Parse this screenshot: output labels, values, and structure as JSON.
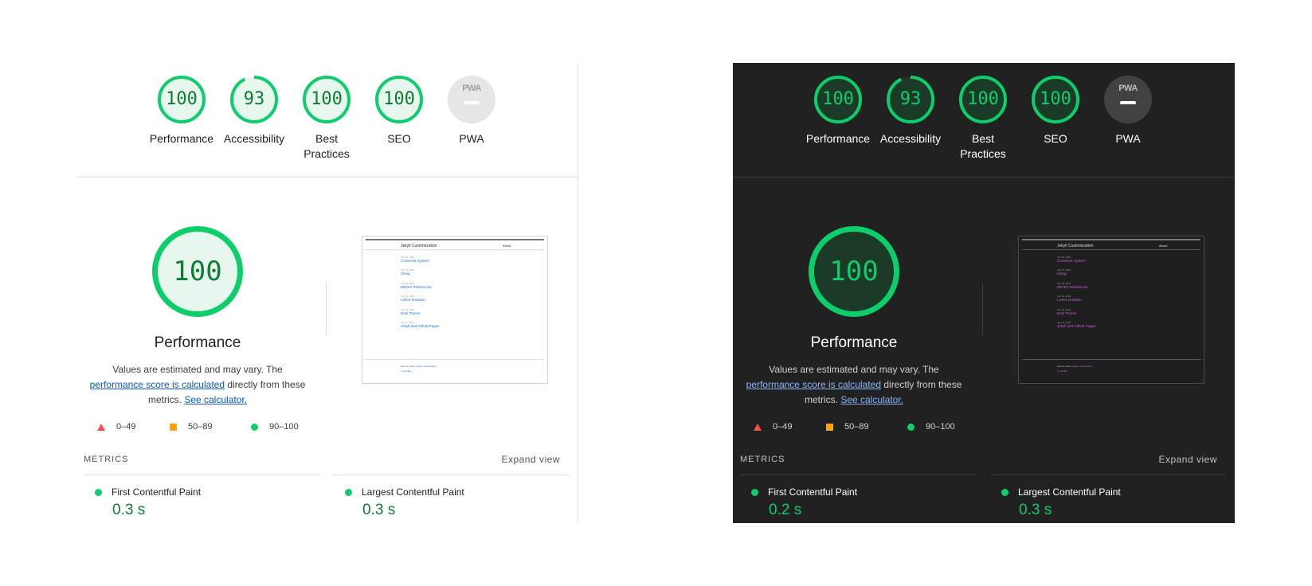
{
  "colors": {
    "pass": "#0cce6b",
    "pass_fill": "#e8f7ee",
    "pass_fill_dark": "#1c3a28",
    "average": "#ffa400",
    "fail": "#ff4e42"
  },
  "light": {
    "gauges": [
      {
        "score": "100",
        "label": "Performance",
        "fraction": 1.0
      },
      {
        "score": "93",
        "label": "Accessibility",
        "fraction": 0.93
      },
      {
        "score": "100",
        "label": "Best Practices",
        "fraction": 1.0
      },
      {
        "score": "100",
        "label": "SEO",
        "fraction": 1.0
      }
    ],
    "pwa": {
      "badge": "PWA",
      "label": "PWA"
    },
    "performance": {
      "score": "100",
      "title": "Performance",
      "desc_1": "Values are estimated and may vary. The ",
      "link_1": "performance score is calculated",
      "desc_2": " directly from these metrics. ",
      "link_2": "See calculator."
    },
    "legend": {
      "fail": "0–49",
      "average": "50–89",
      "pass": "90–100"
    },
    "metrics_title": "METRICS",
    "expand": "Expand view",
    "metrics": [
      {
        "name": "First Contentful Paint",
        "value": "0.3 s"
      },
      {
        "name": "Largest Contentful Paint",
        "value": "0.3 s"
      }
    ]
  },
  "dark": {
    "gauges": [
      {
        "score": "100",
        "label": "Performance",
        "fraction": 1.0
      },
      {
        "score": "93",
        "label": "Accessibility",
        "fraction": 0.93
      },
      {
        "score": "100",
        "label": "Best Practices",
        "fraction": 1.0
      },
      {
        "score": "100",
        "label": "SEO",
        "fraction": 1.0
      }
    ],
    "pwa": {
      "badge": "PWA",
      "label": "PWA"
    },
    "performance": {
      "score": "100",
      "title": "Performance",
      "desc_1": "Values are estimated and may vary. The ",
      "link_1": "performance score is calculated",
      "desc_2": " directly from these metrics. ",
      "link_2": "See calculator."
    },
    "legend": {
      "fail": "0–49",
      "average": "50–89",
      "pass": "90–100"
    },
    "metrics_title": "METRICS",
    "expand": "Expand view",
    "metrics": [
      {
        "name": "First Contentful Paint",
        "value": "0.2 s"
      },
      {
        "name": "Largest Contentful Paint",
        "value": "0.3 s"
      }
    ]
  },
  "screenshot": {
    "site_title": "Jekyll Customization",
    "nav_about": "About",
    "posts": [
      {
        "date": "Jan 18, 2024",
        "title": "Comment System"
      },
      {
        "date": "Jan 17, 2024",
        "title": "Citing"
      },
      {
        "date": "Jan 16, 2024",
        "title": "BibTeX References"
      },
      {
        "date": "Jan 15, 2024",
        "title": "LaTeX Notation"
      },
      {
        "date": "Jan 14, 2024",
        "title": "Dark Theme"
      },
      {
        "date": "Jan 11, 2024",
        "title": "Jekyll and Github Pages"
      }
    ],
    "footer_source": "Source code:",
    "footer_link": "jekyll-customization",
    "footer_copy": "© ukonka"
  }
}
